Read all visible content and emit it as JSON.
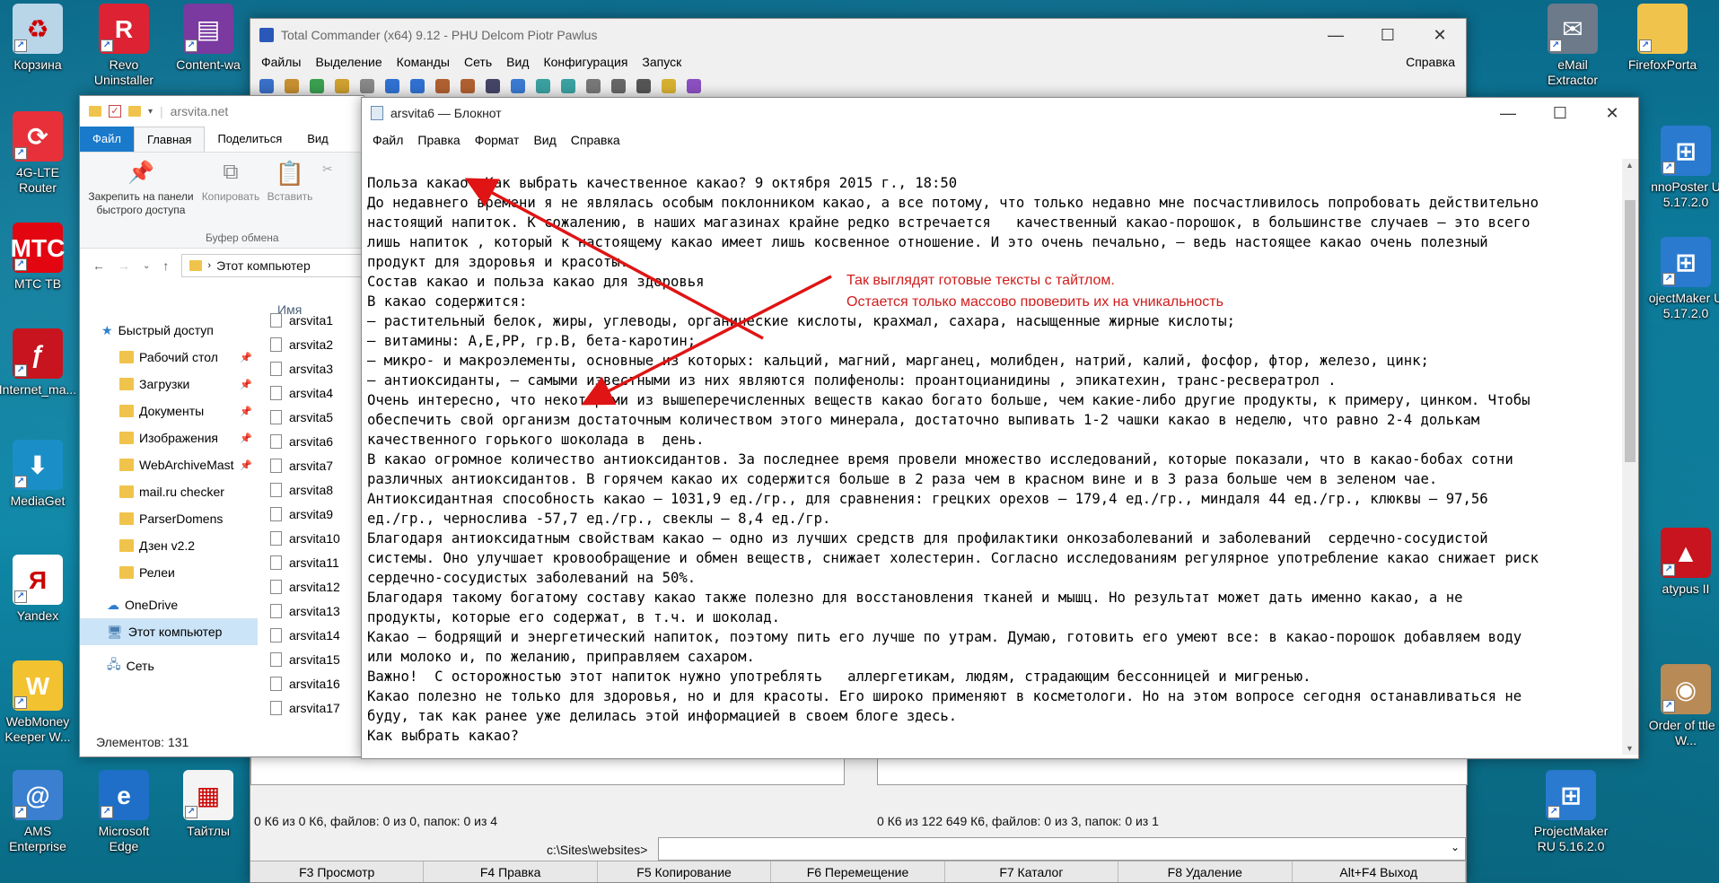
{
  "desktop": {
    "left_icons": [
      {
        "label": "Корзина",
        "icon": "recycle-bin-icon"
      },
      {
        "label": "4G-LTE Router",
        "icon": "router-icon"
      },
      {
        "label": "МТС ТВ",
        "icon": "mts-tv-icon"
      },
      {
        "label": "Internet_ma...",
        "icon": "flash-icon"
      },
      {
        "label": "MediaGet",
        "icon": "mediaget-icon"
      },
      {
        "label": "Yandex",
        "icon": "yandex-icon"
      },
      {
        "label": "WebMoney Keeper W...",
        "icon": "webmoney-icon"
      },
      {
        "label": "AMS Enterprise",
        "icon": "ams-icon"
      }
    ],
    "second_col_icons": [
      {
        "label": "Revo Uninstaller",
        "icon": "revo-icon"
      },
      {
        "label": "Content-wa",
        "icon": "winrar-icon"
      },
      {
        "label": "Microsoft Edge",
        "icon": "edge-icon"
      },
      {
        "label": "Тайтлы",
        "icon": "tables-icon"
      }
    ],
    "right_icons": [
      {
        "label": "eMail Extractor",
        "icon": "email-extractor-icon"
      },
      {
        "label": "FirefoxPorta",
        "icon": "folder-icon"
      },
      {
        "label": "nnoPoster U 5.17.2.0",
        "icon": "poster-icon"
      },
      {
        "label": "ojectMaker U 5.17.2.0",
        "icon": "projectmaker-icon"
      },
      {
        "label": "atypus II",
        "icon": "platypus-icon"
      },
      {
        "label": "Order of ttle - W...",
        "icon": "order-icon"
      },
      {
        "label": "ProjectMaker RU 5.16.2.0",
        "icon": "projectmaker-icon"
      }
    ]
  },
  "tc": {
    "title": "Total Commander (x64) 9.12 - PHU Delcom Piotr Pawlus",
    "menu": [
      "Файлы",
      "Выделение",
      "Команды",
      "Сеть",
      "Вид",
      "Конфигурация",
      "Запуск"
    ],
    "help": "Справка",
    "left_status": "0 К6 из 0 К6, файлов: 0 из 0, папок: 0 из 4",
    "right_status": "0 К6 из 122 649 К6, файлов: 0 из 3, папок: 0 из 1",
    "path": "c:\\Sites\\websites>",
    "fkeys": [
      "F3 Просмотр",
      "F4 Правка",
      "F5 Копирование",
      "F6 Перемещение",
      "F7 Каталог",
      "F8 Удаление",
      "Alt+F4 Выход"
    ]
  },
  "explorer": {
    "title": "arsvita.net",
    "tabs": [
      "Файл",
      "Главная",
      "Поделиться",
      "Вид"
    ],
    "ribbon": {
      "pin": "Закрепить на панели быстрого доступа",
      "copy": "Копировать",
      "paste": "Вставить",
      "group": "Буфер обмена"
    },
    "address": "Этот компьютер",
    "column": "Имя",
    "tree": [
      {
        "label": "Быстрый доступ",
        "type": "star"
      },
      {
        "label": "Рабочий стол",
        "type": "folder",
        "pinned": true
      },
      {
        "label": "Загрузки",
        "type": "folder",
        "pinned": true
      },
      {
        "label": "Документы",
        "type": "folder",
        "pinned": true
      },
      {
        "label": "Изображения",
        "type": "folder",
        "pinned": true
      },
      {
        "label": "WebArchiveMast",
        "type": "folder",
        "pinned": true
      },
      {
        "label": "mail.ru checker",
        "type": "folder"
      },
      {
        "label": "ParserDomens",
        "type": "folder"
      },
      {
        "label": "Дзен v2.2",
        "type": "folder"
      },
      {
        "label": "Релеи",
        "type": "folder"
      },
      {
        "label": "OneDrive",
        "type": "cloud"
      },
      {
        "label": "Этот компьютер",
        "type": "pc"
      },
      {
        "label": "Сеть",
        "type": "net"
      }
    ],
    "files": [
      "arsvita1",
      "arsvita2",
      "arsvita3",
      "arsvita4",
      "arsvita5",
      "arsvita6",
      "arsvita7",
      "arsvita8",
      "arsvita9",
      "arsvita10",
      "arsvita11",
      "arsvita12",
      "arsvita13",
      "arsvita14",
      "arsvita15",
      "arsvita16",
      "arsvita17"
    ],
    "status": "Элементов: 131"
  },
  "notepad": {
    "title": "arsvita6 — Блокнот",
    "menu": [
      "Файл",
      "Правка",
      "Формат",
      "Вид",
      "Справка"
    ],
    "lines": [
      "Польза какао. Как выбрать качественное какао? 9 октября 2015 г., 18:50",
      "До недавнего времени я не являлась особым поклонником какао, а все потому, что только недавно мне посчастливилось попробовать действительно",
      "настоящий напиток. К сожалению, в наших магазинах крайне редко встречается   качественный какао-порошок, в большинстве случаев — это всего",
      "лишь напиток , который к настоящему какао имеет лишь косвенное отношение. И это очень печально, — ведь настоящее какао очень полезный",
      "продукт для здоровья и красоты.",
      "Состав какао и польза какао для здоровья",
      "В какао содержится:",
      "— растительный белок, жиры, углеводы, органические кислоты, крахмал, сахара, насыщенные жирные кислоты;",
      "— витамины: A,E,PP, гр.B, бета-каротин;",
      "— микро- и макроэлементы, основные из которых: кальций, магний, марганец, молибден, натрий, калий, фосфор, фтор, железо, цинк;",
      "— антиоксиданты, — самыми известными из них являются полифенолы: проантоцианидины , эпикатехин, транс-ресвератрол .",
      "Очень интересно, что некоторыми из вышеперечисленных веществ какао богато больше, чем какие-либо другие продукты, к примеру, цинком. Чтобы",
      "обеспечить свой организм достаточным количеством этого минерала, достаточно выпивать 1-2 чашки какао в неделю, что равно 2-4 долькам",
      "качественного горького шоколада в  день.",
      "В какао огромное количество антиоксидантов. За последнее время провели множество исследований, которые показали, что в какао-бобах сотни",
      "различных антиоксидантов. В горячем какао их содержится больше в 2 раза чем в красном вине и в 3 раза больше чем в зеленом чае.",
      "Антиоксидантная способность какао — 1031,9 ед./гр., для сравнения: грецких орехов — 179,4 ед./гр., миндаля 44 ед./гр., клюквы — 97,56",
      "ед./гр., чернослива -57,7 ед./гр., свеклы — 8,4 ед./гр.",
      "Благодаря антиоксидатным свойствам какао — одно из лучших средств для профилактики онкозаболеваний и заболеваний  сердечно-сосудистой",
      "системы. Оно улучшает кровообращение и обмен веществ, снижает холестерин. Согласно исследованиям регулярное употребление какао снижает риск",
      "сердечно-сосудистых заболеваний на 50%.",
      "Благодаря такому богатому составу какао также полезно для восстановления тканей и мышц. Но результат может дать именно какао, а не",
      "продукты, которые его содержат, в т.ч. и шоколад.",
      "Какао — бодрящий и энергетический напиток, поэтому пить его лучше по утрам. Думаю, готовить его умеют все: в какао-порошок добавляем воду",
      "или молоко и, по желанию, приправляем сахаром.",
      "Важно!  С осторожностью этот напиток нужно употреблять   аллергетикам, людям, страдающим бессонницей и мигренью.",
      "Какао полезно не только для здоровья, но и для красоты. Его широко применяют в косметологи. Но на этом вопросе сегодня останавливаться не",
      "буду, так как ранее уже делилась этой информацией в своем блоге здесь.",
      "Как выбрать какао?"
    ]
  },
  "annotation": {
    "line1": "Так выглядят готовые тексты с тайтлом.",
    "line2": "Остается только массово проверить их на уникальность",
    "color": "#d01c1c"
  }
}
